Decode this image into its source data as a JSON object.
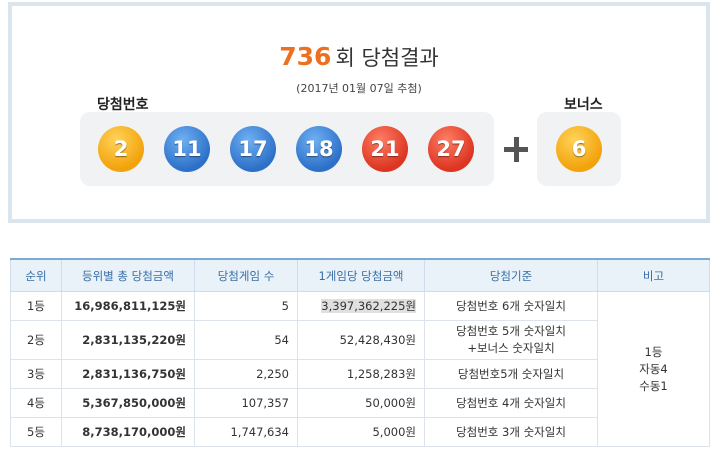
{
  "header": {
    "round": "736",
    "round_suffix": "회 당첨결과",
    "draw_date": "(2017년 01월 07일 추첨)",
    "winning_label": "당첨번호",
    "bonus_label": "보너스"
  },
  "winning_numbers": [
    {
      "value": "2",
      "color": "#f2a20a"
    },
    {
      "value": "11",
      "color": "#2d70c8"
    },
    {
      "value": "17",
      "color": "#2d70c8"
    },
    {
      "value": "18",
      "color": "#2d70c8"
    },
    {
      "value": "21",
      "color": "#dc3521"
    },
    {
      "value": "27",
      "color": "#dc3521"
    }
  ],
  "bonus_number": {
    "value": "6",
    "color": "#f2a20a"
  },
  "table": {
    "headers": [
      "순위",
      "등위별 총 당첨금액",
      "당첨게임 수",
      "1게임당 당첨금액",
      "당첨기준",
      "비고"
    ],
    "rows": [
      {
        "rank": "1등",
        "total": "16,986,811,125원",
        "games": "5",
        "per_game": "3,397,362,225원",
        "criteria": "당첨번호 6개 숫자일치"
      },
      {
        "rank": "2등",
        "total": "2,831,135,220원",
        "games": "54",
        "per_game": "52,428,430원",
        "criteria": "당첨번호 5개 숫자일치",
        "criteria2": "+보너스 숫자일치"
      },
      {
        "rank": "3등",
        "total": "2,831,136,750원",
        "games": "2,250",
        "per_game": "1,258,283원",
        "criteria": "당첨번호5개 숫자일치"
      },
      {
        "rank": "4등",
        "total": "5,367,850,000원",
        "games": "107,357",
        "per_game": "50,000원",
        "criteria": "당첨번호 4개 숫자일치"
      },
      {
        "rank": "5등",
        "total": "8,738,170,000원",
        "games": "1,747,634",
        "per_game": "5,000원",
        "criteria": "당첨번호 3개 숫자일치"
      }
    ],
    "remark": {
      "line1": "1등",
      "line2": "자동4",
      "line3": "수동1"
    }
  }
}
